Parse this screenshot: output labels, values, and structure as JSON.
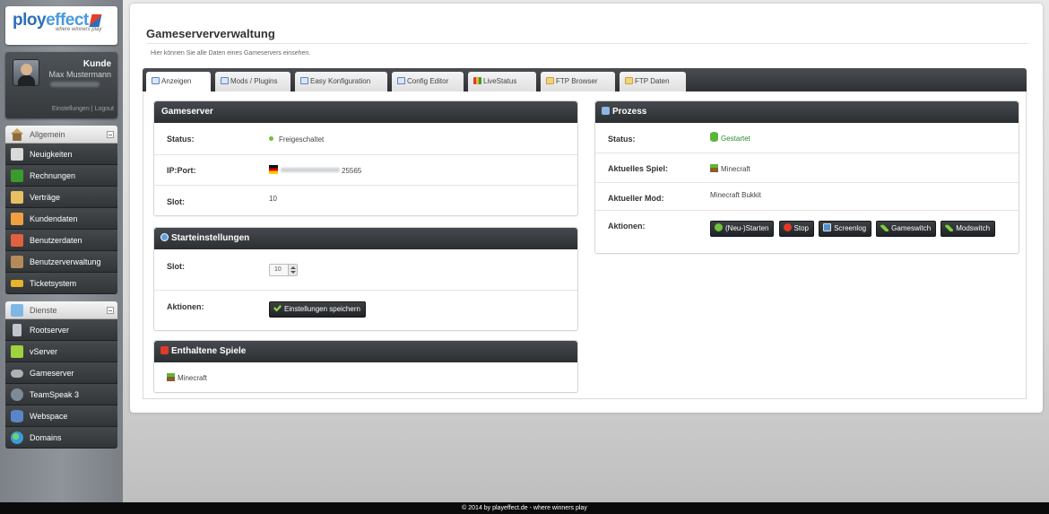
{
  "logo": {
    "brand_a": "ploy",
    "brand_b": "effect",
    "tagline": "where winners play"
  },
  "user": {
    "role": "Kunde",
    "name": "Max Mustermann",
    "link_settings": "Einstellungen",
    "link_sep": "|",
    "link_logout": "Logout"
  },
  "nav": {
    "groups": [
      {
        "title": "Allgemein",
        "icon": "home-icon",
        "items": [
          {
            "label": "Neuigkeiten",
            "icon": "news-icon",
            "color": "#d9d9d9"
          },
          {
            "label": "Rechnungen",
            "icon": "dollar-icon",
            "color": "#3a9a2c"
          },
          {
            "label": "Verträge",
            "icon": "contract-icon",
            "color": "#e8c064"
          },
          {
            "label": "Kundendaten",
            "icon": "user-icon",
            "color": "#f0a040"
          },
          {
            "label": "Benutzerdaten",
            "icon": "user-red-icon",
            "color": "#e06040"
          },
          {
            "label": "Benutzerverwaltung",
            "icon": "users-icon",
            "color": "#b48a5a"
          },
          {
            "label": "Ticketsystem",
            "icon": "ticket-icon",
            "color": "#e9b32a"
          }
        ]
      },
      {
        "title": "Dienste",
        "icon": "services-icon",
        "items": [
          {
            "label": "Rootserver",
            "icon": "server-icon",
            "color": "#c0c6cc"
          },
          {
            "label": "vServer",
            "icon": "cubes-icon",
            "color": "#9fd23c"
          },
          {
            "label": "Gameserver",
            "icon": "gamepad-icon",
            "color": "#aeb3b8"
          },
          {
            "label": "TeamSpeak 3",
            "icon": "teamspeak-icon",
            "color": "#7e8a96"
          },
          {
            "label": "Webspace",
            "icon": "database-icon",
            "color": "#5a86c8"
          },
          {
            "label": "Domains",
            "icon": "globe-icon",
            "color": "#3a9ad8"
          }
        ]
      }
    ]
  },
  "page": {
    "title": "Gameserververwaltung",
    "description": "Hier können Sie alle Daten eines Gameservers einsehen."
  },
  "tabs": [
    {
      "label": "Anzeigen",
      "active": true
    },
    {
      "label": "Mods / Plugins",
      "active": false
    },
    {
      "label": "Easy Konfiguration",
      "active": false
    },
    {
      "label": "Config Editor",
      "active": false
    },
    {
      "label": "LiveStatus",
      "active": false
    },
    {
      "label": "FTP Browser",
      "active": false
    },
    {
      "label": "FTP Daten",
      "active": false
    }
  ],
  "gameserver": {
    "title": "Gameserver",
    "status_label": "Status:",
    "status_value": "Freigeschaltet",
    "ipport_label": "IP:Port:",
    "port_value": "25565",
    "slot_label": "Slot:",
    "slot_value": "10"
  },
  "start": {
    "title": "Starteinstellungen",
    "slot_label": "Slot:",
    "slot_value": "10",
    "actions_label": "Aktionen:",
    "save_button": "Einstellungen speichern"
  },
  "games": {
    "title": "Enthaltene Spiele",
    "items": [
      "Minecraft"
    ]
  },
  "process": {
    "title": "Prozess",
    "status_label": "Status:",
    "status_value": "Gestartet",
    "current_game_label": "Aktuelles Spiel:",
    "current_game_value": "Minecraft",
    "current_mod_label": "Aktueller Mod:",
    "current_mod_value": "Minecraft Bukkit",
    "actions_label": "Aktionen:",
    "buttons": {
      "restart": "(Neu-)Starten",
      "stop": "Stop",
      "screenlog": "Screenlog",
      "gameswitch": "Gameswitch",
      "modswitch": "Modswitch"
    }
  },
  "footer": "© 2014 by playeffect.de - where winners play",
  "colors": {
    "status_green": "#6fc03a",
    "process_green": "#2e8b2e",
    "stop_red": "#e23a2a"
  }
}
